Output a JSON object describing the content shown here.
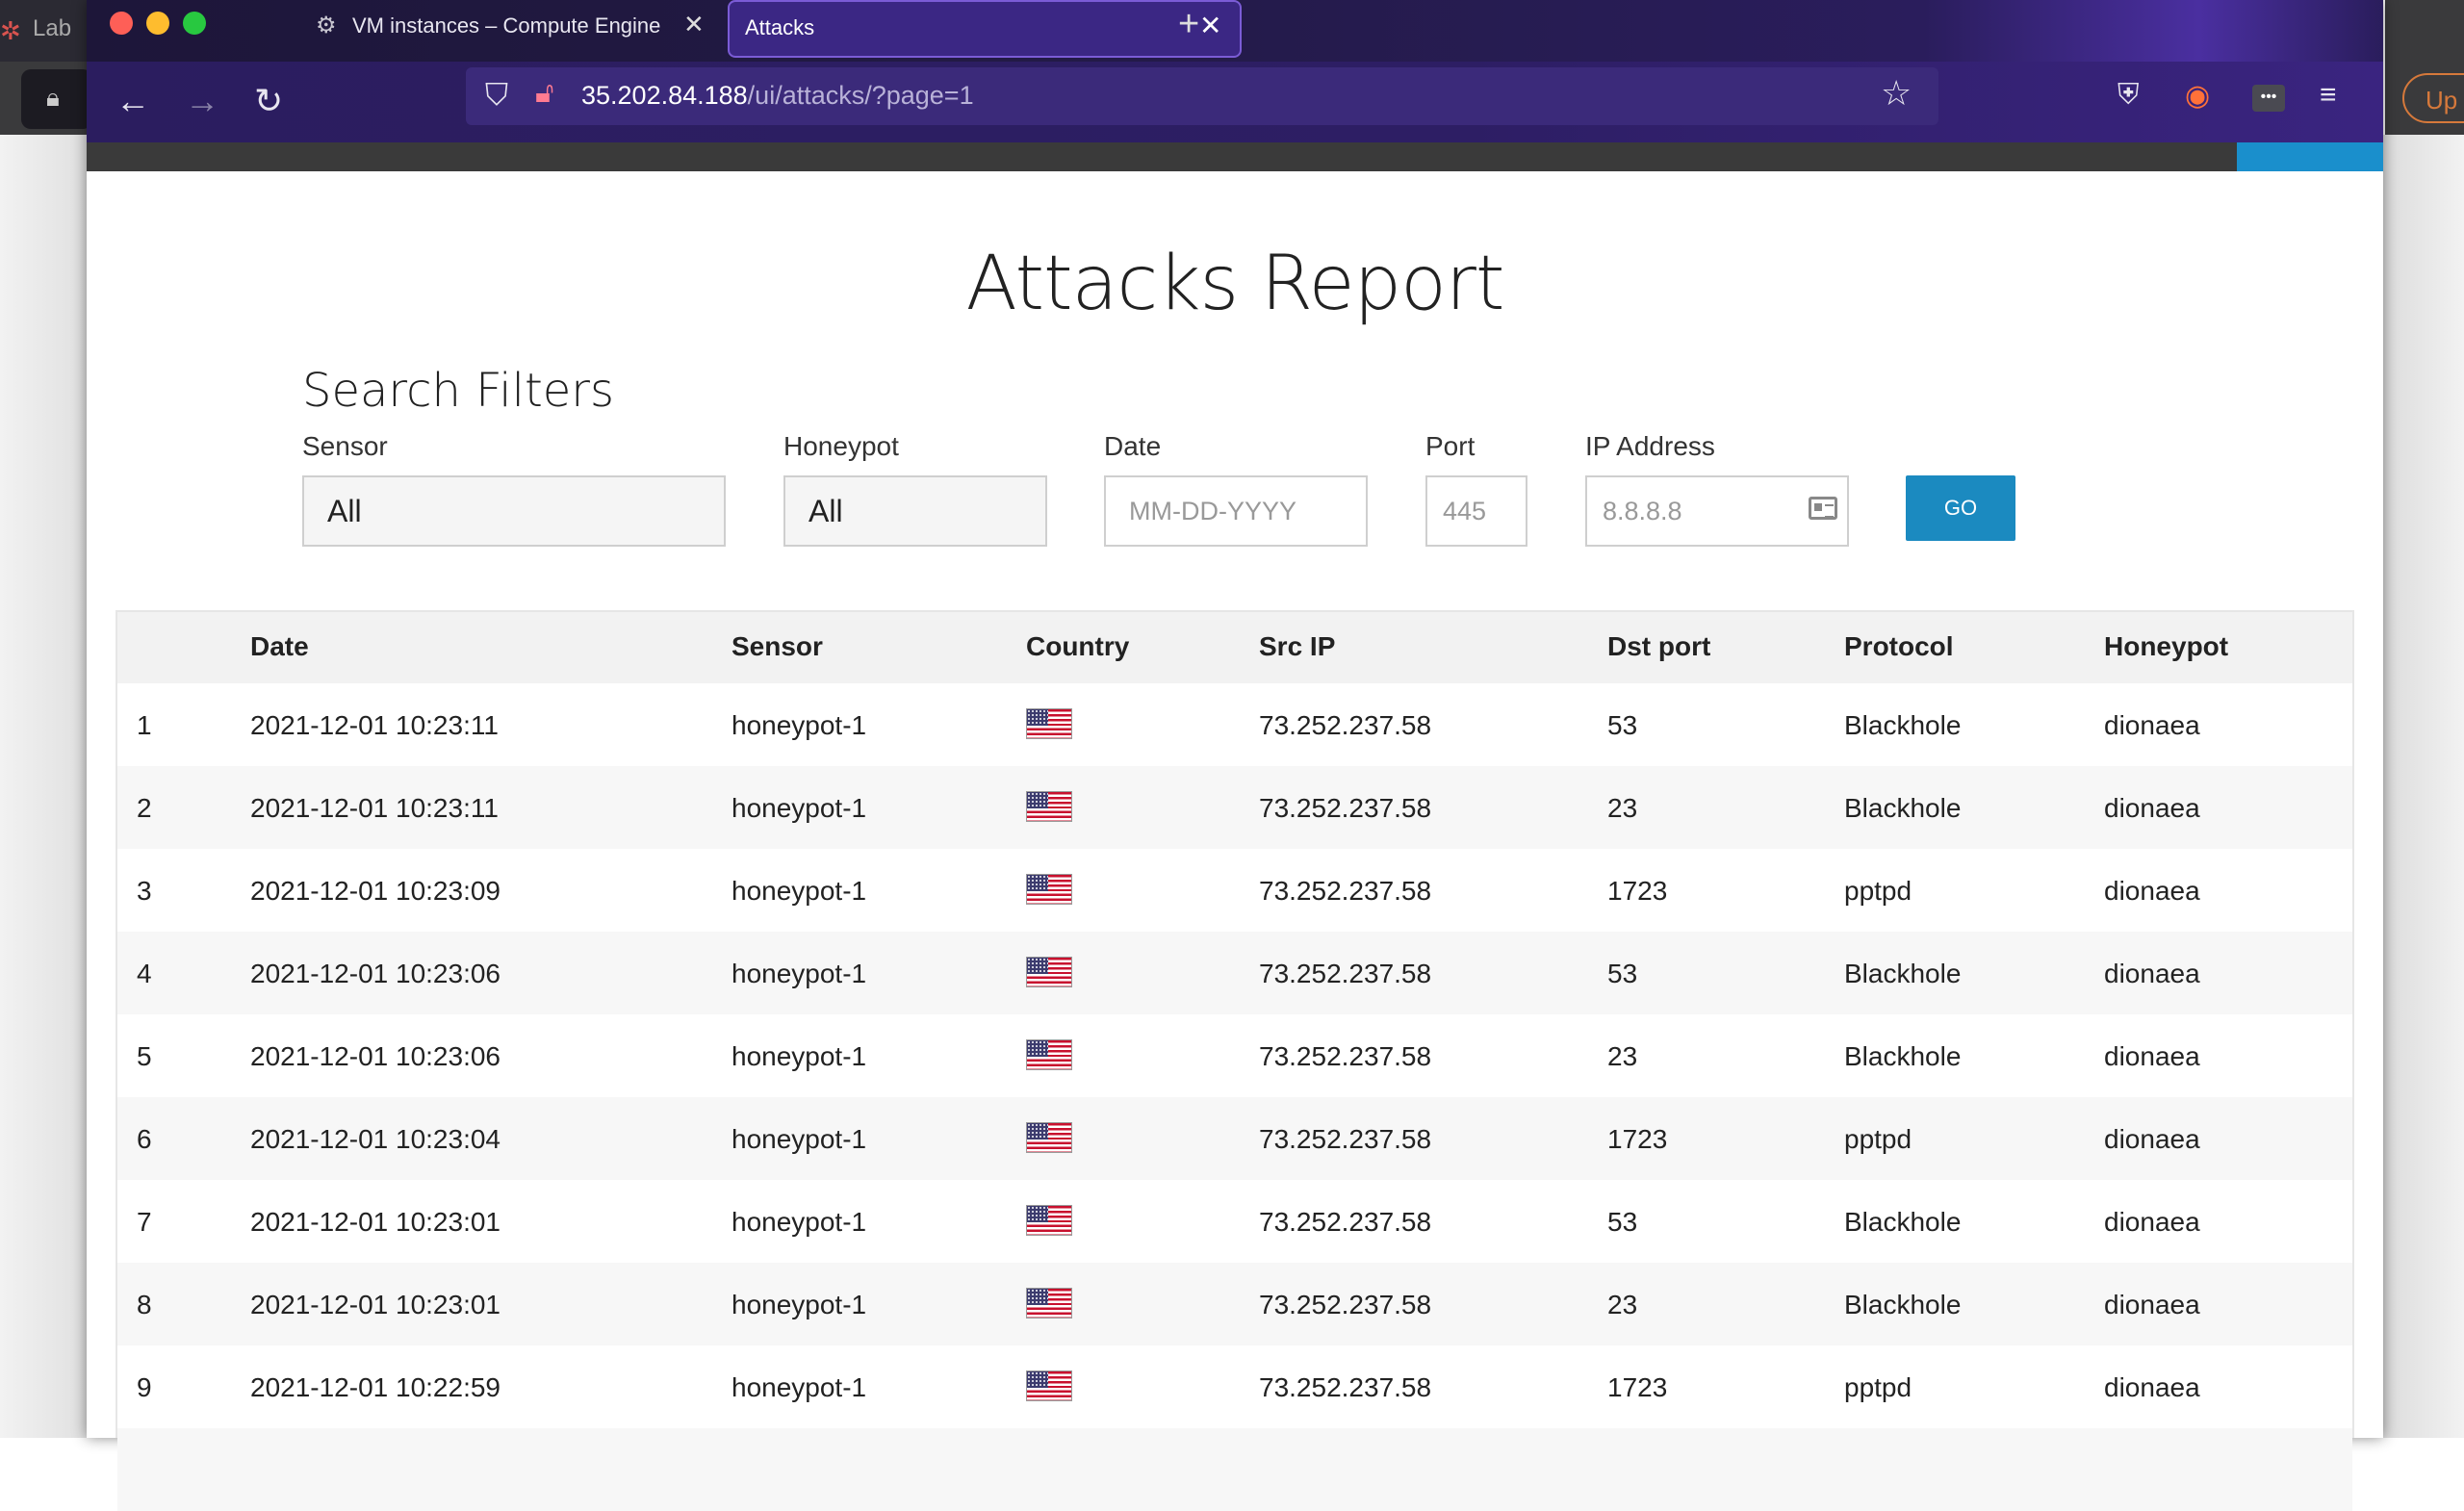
{
  "background_window": {
    "left_tab_label": "Lab",
    "right_button_label": "Up"
  },
  "browser": {
    "tabs": [
      {
        "label": "VM instances – Compute Engine",
        "icon": "gcp-icon",
        "active": false
      },
      {
        "label": "Attacks",
        "active": true
      }
    ],
    "url": {
      "host": "35.202.84.188",
      "path": "/ui/attacks/?page=1"
    },
    "toolbar_icons": [
      "pocket-icon",
      "firefox-account-icon",
      "extension-icon",
      "hamburger-menu-icon"
    ]
  },
  "page": {
    "title": "Attacks Report",
    "filters": {
      "heading": "Search Filters",
      "sensor": {
        "label": "Sensor",
        "value": "All"
      },
      "honeypot": {
        "label": "Honeypot",
        "value": "All"
      },
      "date": {
        "label": "Date",
        "placeholder": "MM-DD-YYYY"
      },
      "port": {
        "label": "Port",
        "placeholder": "445"
      },
      "ip": {
        "label": "IP Address",
        "placeholder": "8.8.8.8"
      },
      "go_label": "GO"
    },
    "table": {
      "columns": [
        "",
        "Date",
        "Sensor",
        "Country",
        "Src IP",
        "Dst port",
        "Protocol",
        "Honeypot"
      ],
      "rows": [
        {
          "idx": "1",
          "date": "2021-12-01 10:23:11",
          "sensor": "honeypot-1",
          "country": "us-flag",
          "src_ip": "73.252.237.58",
          "dst_port": "53",
          "protocol": "Blackhole",
          "honeypot": "dionaea"
        },
        {
          "idx": "2",
          "date": "2021-12-01 10:23:11",
          "sensor": "honeypot-1",
          "country": "us-flag",
          "src_ip": "73.252.237.58",
          "dst_port": "23",
          "protocol": "Blackhole",
          "honeypot": "dionaea"
        },
        {
          "idx": "3",
          "date": "2021-12-01 10:23:09",
          "sensor": "honeypot-1",
          "country": "us-flag",
          "src_ip": "73.252.237.58",
          "dst_port": "1723",
          "protocol": "pptpd",
          "honeypot": "dionaea"
        },
        {
          "idx": "4",
          "date": "2021-12-01 10:23:06",
          "sensor": "honeypot-1",
          "country": "us-flag",
          "src_ip": "73.252.237.58",
          "dst_port": "53",
          "protocol": "Blackhole",
          "honeypot": "dionaea"
        },
        {
          "idx": "5",
          "date": "2021-12-01 10:23:06",
          "sensor": "honeypot-1",
          "country": "us-flag",
          "src_ip": "73.252.237.58",
          "dst_port": "23",
          "protocol": "Blackhole",
          "honeypot": "dionaea"
        },
        {
          "idx": "6",
          "date": "2021-12-01 10:23:04",
          "sensor": "honeypot-1",
          "country": "us-flag",
          "src_ip": "73.252.237.58",
          "dst_port": "1723",
          "protocol": "pptpd",
          "honeypot": "dionaea"
        },
        {
          "idx": "7",
          "date": "2021-12-01 10:23:01",
          "sensor": "honeypot-1",
          "country": "us-flag",
          "src_ip": "73.252.237.58",
          "dst_port": "53",
          "protocol": "Blackhole",
          "honeypot": "dionaea"
        },
        {
          "idx": "8",
          "date": "2021-12-01 10:23:01",
          "sensor": "honeypot-1",
          "country": "us-flag",
          "src_ip": "73.252.237.58",
          "dst_port": "23",
          "protocol": "Blackhole",
          "honeypot": "dionaea"
        },
        {
          "idx": "9",
          "date": "2021-12-01 10:22:59",
          "sensor": "honeypot-1",
          "country": "us-flag",
          "src_ip": "73.252.237.58",
          "dst_port": "1723",
          "protocol": "pptpd",
          "honeypot": "dionaea"
        }
      ]
    }
  },
  "colors": {
    "accent": "#1b8ac0",
    "tab_active": "#3b2784",
    "browser_chrome": "#2b1d5f"
  }
}
